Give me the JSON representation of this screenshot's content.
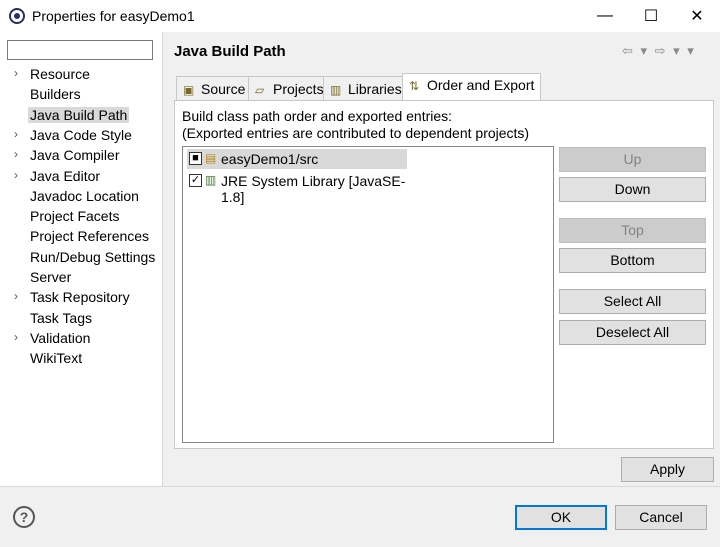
{
  "window": {
    "title": "Properties for easyDemo1",
    "minimize_glyph": "—",
    "maximize_glyph": "☐",
    "close_glyph": "✕"
  },
  "sidebar": {
    "filter_value": "",
    "items": [
      {
        "label": "Resource",
        "expandable": true
      },
      {
        "label": "Builders",
        "expandable": false
      },
      {
        "label": "Java Build Path",
        "expandable": false,
        "selected": true
      },
      {
        "label": "Java Code Style",
        "expandable": true
      },
      {
        "label": "Java Compiler",
        "expandable": true
      },
      {
        "label": "Java Editor",
        "expandable": true
      },
      {
        "label": "Javadoc Location",
        "expandable": false
      },
      {
        "label": "Project Facets",
        "expandable": false
      },
      {
        "label": "Project References",
        "expandable": false
      },
      {
        "label": "Run/Debug Settings",
        "expandable": false
      },
      {
        "label": "Server",
        "expandable": false
      },
      {
        "label": "Task Repository",
        "expandable": true
      },
      {
        "label": "Task Tags",
        "expandable": false
      },
      {
        "label": "Validation",
        "expandable": true
      },
      {
        "label": "WikiText",
        "expandable": false
      }
    ]
  },
  "page": {
    "title": "Java Build Path",
    "nav_arrows": "⇦ ▾ ⇨ ▾ ▾"
  },
  "tabs": [
    {
      "label": "Source",
      "icon": "source-folder-icon"
    },
    {
      "label": "Projects",
      "icon": "projects-icon"
    },
    {
      "label": "Libraries",
      "icon": "libraries-icon"
    },
    {
      "label": "Order and Export",
      "icon": "order-export-icon",
      "active": true
    }
  ],
  "order_export": {
    "description_line1": "Build class path order and exported entries:",
    "description_line2": "(Exported entries are contributed to dependent projects)",
    "entries": [
      {
        "label": "easyDemo1/src",
        "check": "■",
        "icon": "package-folder-icon",
        "selected": true
      },
      {
        "label": "JRE System Library [JavaSE-1.8]",
        "check": "✓",
        "icon": "library-icon",
        "selected": false
      }
    ],
    "buttons": {
      "up": "Up",
      "down": "Down",
      "top": "Top",
      "bottom": "Bottom",
      "select_all": "Select All",
      "deselect_all": "Deselect All"
    }
  },
  "footer": {
    "apply": "Apply",
    "ok": "OK",
    "cancel": "Cancel",
    "help_glyph": "?"
  },
  "colors": {
    "selection": "#d9d9d9",
    "default_button_border": "#0078d7"
  }
}
